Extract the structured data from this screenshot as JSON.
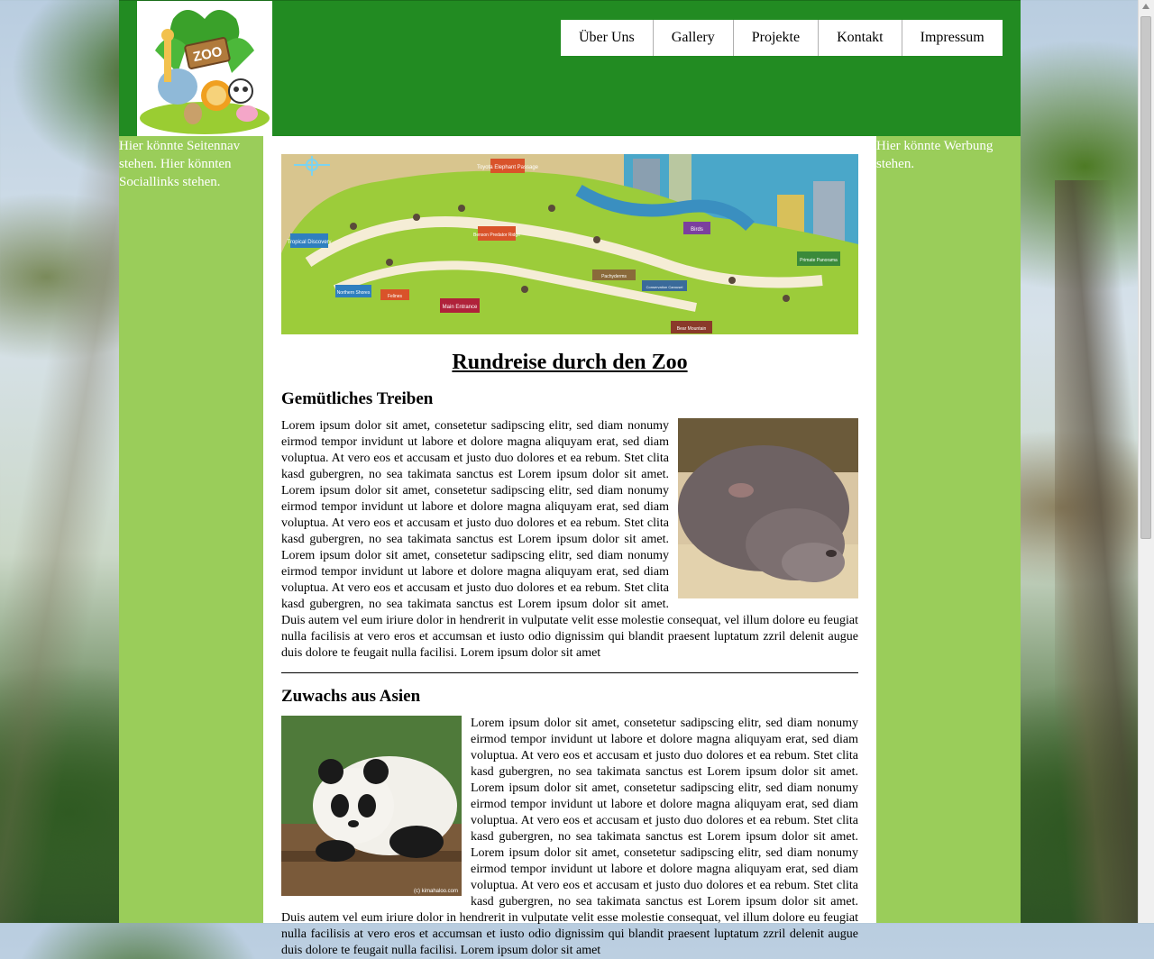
{
  "nav": {
    "items": [
      "Über Uns",
      "Gallery",
      "Projekte",
      "Kontakt",
      "Impressum"
    ]
  },
  "logo": {
    "text": "ZOO"
  },
  "sidebar_left": {
    "text": "Hier könnte Seitennav stehen. Hier könnten Sociallinks stehen."
  },
  "sidebar_right": {
    "text": "Hier könnte Werbung stehen."
  },
  "map": {
    "labels": [
      "Toyota Elephant Passage",
      "Tropical Discovery",
      "Benson Predator Ridge",
      "Birds",
      "Primate Panorama",
      "Northern Shores",
      "Felines",
      "Main Entrance",
      "Pachyderms",
      "Bear Mountain",
      "Conservation Carousel"
    ]
  },
  "main": {
    "title": "Rundreise durch den Zoo",
    "sections": [
      {
        "heading": "Gemütliches Treiben",
        "text": "Lorem ipsum dolor sit amet, consetetur sadipscing elitr, sed diam nonumy eirmod tempor invidunt ut labore et dolore magna aliquyam erat, sed diam voluptua. At vero eos et accusam et justo duo dolores et ea rebum. Stet clita kasd gubergren, no sea takimata sanctus est Lorem ipsum dolor sit amet. Lorem ipsum dolor sit amet, consetetur sadipscing elitr, sed diam nonumy eirmod tempor invidunt ut labore et dolore magna aliquyam erat, sed diam voluptua. At vero eos et accusam et justo duo dolores et ea rebum. Stet clita kasd gubergren, no sea takimata sanctus est Lorem ipsum dolor sit amet. Lorem ipsum dolor sit amet, consetetur sadipscing elitr, sed diam nonumy eirmod tempor invidunt ut labore et dolore magna aliquyam erat, sed diam voluptua. At vero eos et accusam et justo duo dolores et ea rebum. Stet clita kasd gubergren, no sea takimata sanctus est Lorem ipsum dolor sit amet. Duis autem vel eum iriure dolor in hendrerit in vulputate velit esse molestie consequat, vel illum dolore eu feugiat nulla facilisis at vero eros et accumsan et iusto odio dignissim qui blandit praesent luptatum zzril delenit augue duis dolore te feugait nulla facilisi. Lorem ipsum dolor sit amet"
      },
      {
        "heading": "Zuwachs aus Asien",
        "text": "Lorem ipsum dolor sit amet, consetetur sadipscing elitr, sed diam nonumy eirmod tempor invidunt ut labore et dolore magna aliquyam erat, sed diam voluptua. At vero eos et accusam et justo duo dolores et ea rebum. Stet clita kasd gubergren, no sea takimata sanctus est Lorem ipsum dolor sit amet. Lorem ipsum dolor sit amet, consetetur sadipscing elitr, sed diam nonumy eirmod tempor invidunt ut labore et dolore magna aliquyam erat, sed diam voluptua. At vero eos et accusam et justo duo dolores et ea rebum. Stet clita kasd gubergren, no sea takimata sanctus est Lorem ipsum dolor sit amet. Lorem ipsum dolor sit amet, consetetur sadipscing elitr, sed diam nonumy eirmod tempor invidunt ut labore et dolore magna aliquyam erat, sed diam voluptua. At vero eos et accusam et justo duo dolores et ea rebum. Stet clita kasd gubergren, no sea takimata sanctus est Lorem ipsum dolor sit amet. Duis autem vel eum iriure dolor in hendrerit in vulputate velit esse molestie consequat, vel illum dolore eu feugiat nulla facilisis at vero eros et accumsan et iusto odio dignissim qui blandit praesent luptatum zzril delenit augue duis dolore te feugait nulla facilisi. Lorem ipsum dolor sit amet",
        "photo_credit": "(c) kimahaloo.com"
      }
    ]
  },
  "colors": {
    "header_green": "#228b22",
    "sidebar_green": "#9acd5a"
  }
}
